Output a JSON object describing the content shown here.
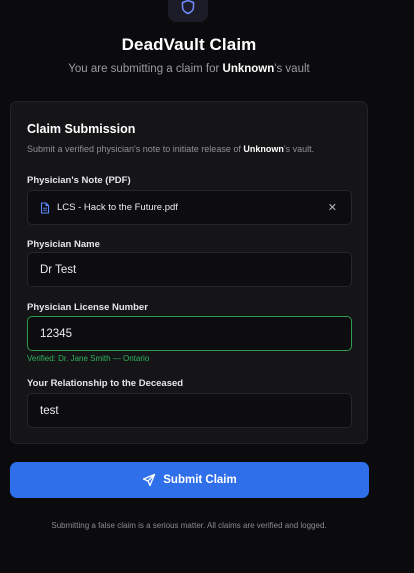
{
  "header": {
    "title": "DeadVault Claim",
    "subtitle_prefix": "You are submitting a claim for ",
    "subtitle_name": "Unknown",
    "subtitle_suffix": "'s vault"
  },
  "card": {
    "title": "Claim Submission",
    "desc_prefix": "Submit a verified physician's note to initiate release of ",
    "desc_name": "Unknown",
    "desc_suffix": "'s vault."
  },
  "fields": {
    "note": {
      "label": "Physician's Note (PDF)",
      "file_name": "LCS - Hack to the Future.pdf",
      "remove_glyph": "✕"
    },
    "name": {
      "label": "Physician Name",
      "value": "Dr Test"
    },
    "license": {
      "label": "Physician License Number",
      "value": "12345",
      "verified_text": "Verified: Dr. Jane Smith — Ontario"
    },
    "relationship": {
      "label": "Your Relationship to the Deceased",
      "value": "test"
    }
  },
  "submit": {
    "label": "Submit Claim"
  },
  "footer": {
    "note": "Submitting a false claim is a serious matter. All claims are verified and logged."
  },
  "colors": {
    "accent": "#2f6fea",
    "verified": "#31b35a",
    "background": "#0b0b0d",
    "card": "#151517"
  },
  "icons": {
    "logo": "shield-icon",
    "file": "file-icon",
    "remove": "close-icon",
    "submit": "send-icon"
  }
}
